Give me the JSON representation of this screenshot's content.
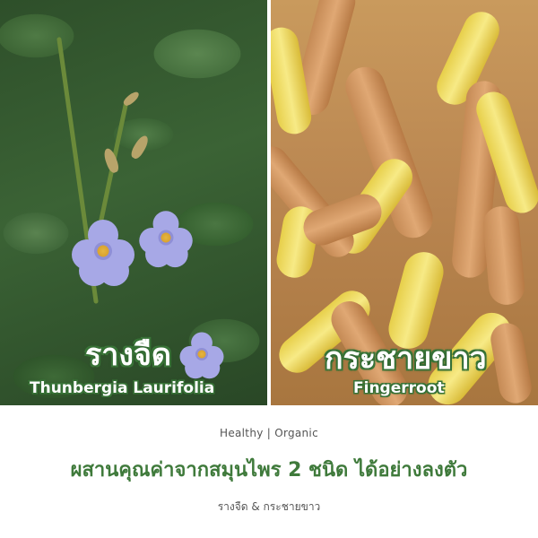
{
  "panels": {
    "left": {
      "thai_name": "รางจืด",
      "english_name": "Thunbergia Laurifolia"
    },
    "right": {
      "thai_name": "กระชายขาว",
      "english_name": "Fingerroot"
    }
  },
  "footer": {
    "tagline": "Healthy | Organic",
    "headline": "ผสานคุณค่าจากสมุนไพร 2 ชนิด ได้อย่างลงตัว",
    "subline": "รางจืด & กระชายขาว"
  },
  "colors": {
    "brand_green": "#3f7a3b",
    "caption_outline": "#3b7a3a",
    "flower_lavender": "#a7a8e6",
    "root_yellow": "#f7ea86"
  }
}
